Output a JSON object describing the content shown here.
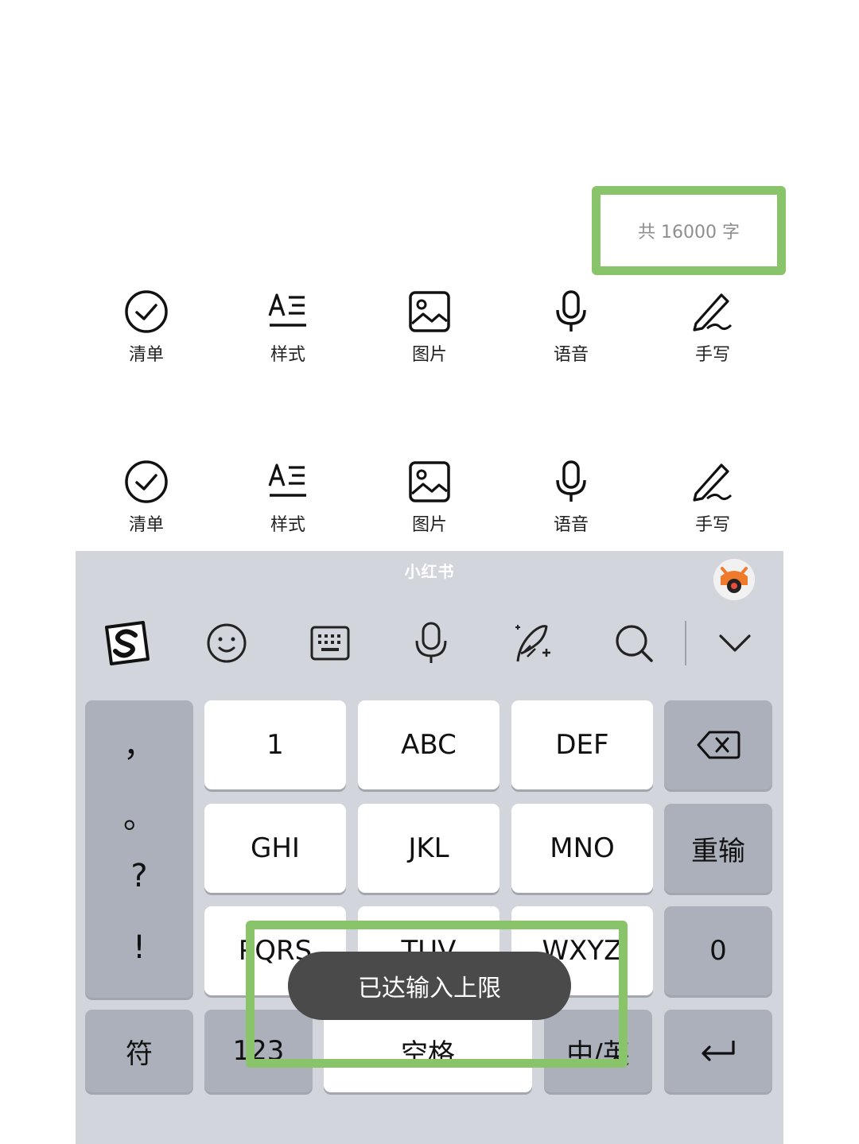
{
  "note": {
    "char_count": "共 16000 字"
  },
  "toolbar_rows": [
    {
      "items": [
        {
          "label": "清单",
          "icon": "checklist-icon"
        },
        {
          "label": "样式",
          "icon": "text-style-icon"
        },
        {
          "label": "图片",
          "icon": "image-icon"
        },
        {
          "label": "语音",
          "icon": "microphone-icon"
        },
        {
          "label": "手写",
          "icon": "handwriting-icon"
        }
      ]
    },
    {
      "items": [
        {
          "label": "清单",
          "icon": "checklist-icon"
        },
        {
          "label": "样式",
          "icon": "text-style-icon"
        },
        {
          "label": "图片",
          "icon": "image-icon"
        },
        {
          "label": "语音",
          "icon": "microphone-icon"
        },
        {
          "label": "手写",
          "icon": "handwriting-icon"
        }
      ]
    }
  ],
  "keyboard": {
    "brand": "小红书",
    "tools": [
      "sogou-logo-icon",
      "emoji-icon",
      "keyboard-icon",
      "microphone-icon",
      "handwriting-icon",
      "search-icon",
      "chevron-down-icon"
    ],
    "punctuation": [
      "，",
      "。",
      "?",
      "!"
    ],
    "keys": {
      "k1": "1",
      "abc": "ABC",
      "def": "DEF",
      "ghi": "GHI",
      "jkl": "JKL",
      "mno": "MNO",
      "reinput": "重输",
      "pqrs": "PQRS",
      "tuv": "TUV",
      "wxyz": "WXYZ",
      "zero": "0",
      "symbols": "符",
      "numbers": "123",
      "space": "空格",
      "lang": "中/英"
    }
  },
  "toast": {
    "message": "已达输入上限"
  },
  "colors": {
    "highlight": "#8ac46a",
    "keyboard_bg": "#d3d5dd"
  }
}
